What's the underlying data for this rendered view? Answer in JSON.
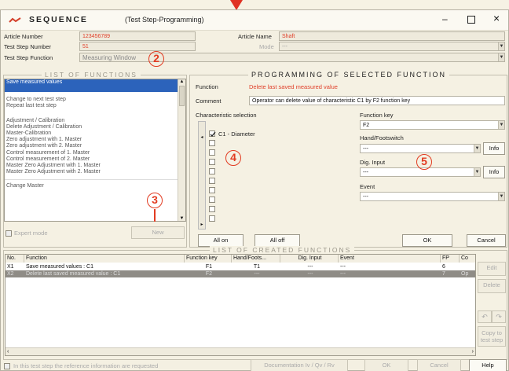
{
  "window": {
    "title": "SEQUENCE",
    "subtitle": "(Test Step-Programming)"
  },
  "header": {
    "article_number_label": "Article Number",
    "article_number": "123456789",
    "article_name_label": "Article Name",
    "article_name": "Shaft",
    "test_step_number_label": "Test Step Number",
    "test_step_number": "51",
    "mode_label": "Mode",
    "mode_value": "---",
    "test_step_function_label": "Test Step Function",
    "test_step_function": "Measuring Window"
  },
  "callouts": {
    "c2": "2",
    "c3": "3",
    "c4": "4",
    "c5": "5"
  },
  "functions": {
    "title": "LIST OF FUNCTIONS",
    "items": [
      "Save measured values",
      "Change to next test step",
      "Repeat last test step",
      "Adjustment / Calibration",
      "Delete Adjustment / Calibration",
      "Master-Calibration",
      "Zero adjustment with 1. Master",
      "Zero adjustment with 2. Master",
      "Control measurement of 1. Master",
      "Control measurement of 2. Master",
      "Master Zero Adjustment with 1. Master",
      "Master Zero Adjustment with 2. Master",
      "Change Master"
    ],
    "expert_mode": "Expert mode",
    "new_button": "New"
  },
  "programming": {
    "title": "PROGRAMMING OF SELECTED FUNCTION",
    "function_label": "Function",
    "function_value": "Delete last saved measured value",
    "comment_label": "Comment",
    "comment": "Operator can delete value of characteristic C1 by F2 function key",
    "char_label": "Characteristic selection",
    "characteristic_1": "C1 - Diameter",
    "all_on": "All on",
    "all_off": "All off",
    "function_key_label": "Function key",
    "function_key": "F2",
    "hand_label": "Hand/Footswitch",
    "hand_value": "---",
    "dig_label": "Dig. Input",
    "dig_value": "---",
    "event_label": "Event",
    "event_value": "---",
    "info": "Info",
    "ok": "OK",
    "cancel": "Cancel"
  },
  "created": {
    "title": "LIST OF CREATED FUNCTIONS",
    "columns": [
      "No.",
      "Function",
      "Function key",
      "Hand/Foots...",
      "Dig. Input",
      "Event",
      "FP",
      "Co"
    ],
    "rows": [
      [
        "X1",
        "Save measured values : C1",
        "F1",
        "T1",
        "---",
        "---",
        "6",
        ""
      ],
      [
        "X2",
        "Delete last saved measured value : C1",
        "F2",
        "---",
        "---",
        "---",
        "7",
        "Op"
      ]
    ],
    "edit": "Edit",
    "delete": "Delete",
    "copy": "Copy to test step"
  },
  "footer": {
    "reference_info": "In this test step the reference information are requested",
    "documentation": "Documentation Iv / Qv / Rv",
    "ok": "OK",
    "cancel": "Cancel",
    "help": "Help"
  }
}
